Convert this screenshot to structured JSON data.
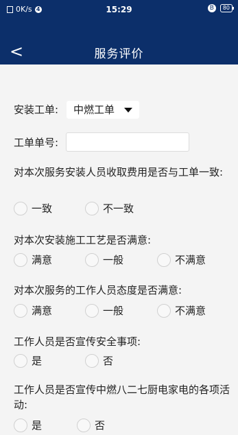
{
  "status_bar": {
    "network_speed": "0K/s",
    "badge": "4",
    "time": "15:29",
    "bluetooth": "B",
    "battery": "80"
  },
  "nav": {
    "back_symbol": "<",
    "title": "服务评价"
  },
  "form": {
    "install_order_label": "安装工单:",
    "install_order_value": "中燃工单",
    "order_no_label": "工单单号:",
    "order_no_value": "",
    "questions": [
      {
        "text": "对本次服务安装人员收取费用是否与工单一致:",
        "options": [
          "一致",
          "不一致"
        ]
      },
      {
        "text": "对本次安装施工工艺是否满意:",
        "options": [
          "满意",
          "一般",
          "不满意"
        ]
      },
      {
        "text": "对本次服务的工作人员态度是否满意:",
        "options": [
          "满意",
          "一般",
          "不满意"
        ]
      },
      {
        "text": "工作人员是否宣传安全事项:",
        "options": [
          "是",
          "否"
        ]
      },
      {
        "text": "工作人员是否宣传中燃八二七厨电家电的各项活动:",
        "options": [
          "是",
          "否"
        ]
      }
    ]
  },
  "colors": {
    "header": "#0c2f6a",
    "background": "#f4f4f4"
  }
}
